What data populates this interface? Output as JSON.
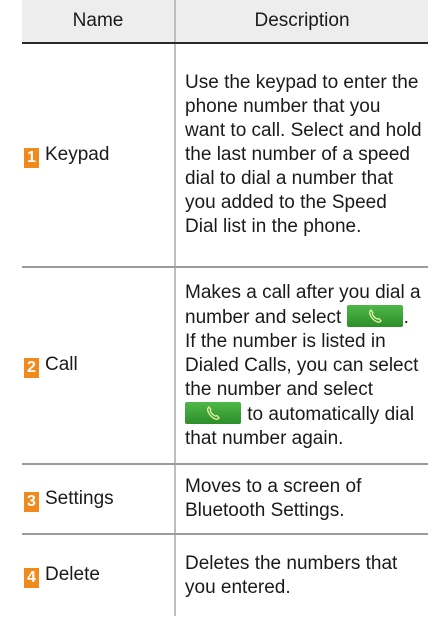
{
  "table": {
    "headers": {
      "name": "Name",
      "description": "Description"
    },
    "rows": [
      {
        "number": "1",
        "name": "Keypad",
        "description": "Use the keypad to enter the phone number that you want to call. Select and hold the last number of a speed dial to dial a number that you added to the Speed Dial list in the phone."
      },
      {
        "number": "2",
        "name": "Call",
        "description_parts": [
          "Makes a call after you dial a number and select ",
          ". If the number is listed in Dialed Calls, you can select the number and select ",
          " to automatically dial that number again."
        ],
        "icon": "call-button-icon"
      },
      {
        "number": "3",
        "name": "Settings",
        "description": "Moves to a screen of Bluetooth Settings."
      },
      {
        "number": "4",
        "name": "Delete",
        "description": "Deletes the numbers that you entered."
      }
    ]
  },
  "colors": {
    "badge": "#f08a1c",
    "call_button": "#3aa237",
    "header_background": "#ededed"
  }
}
